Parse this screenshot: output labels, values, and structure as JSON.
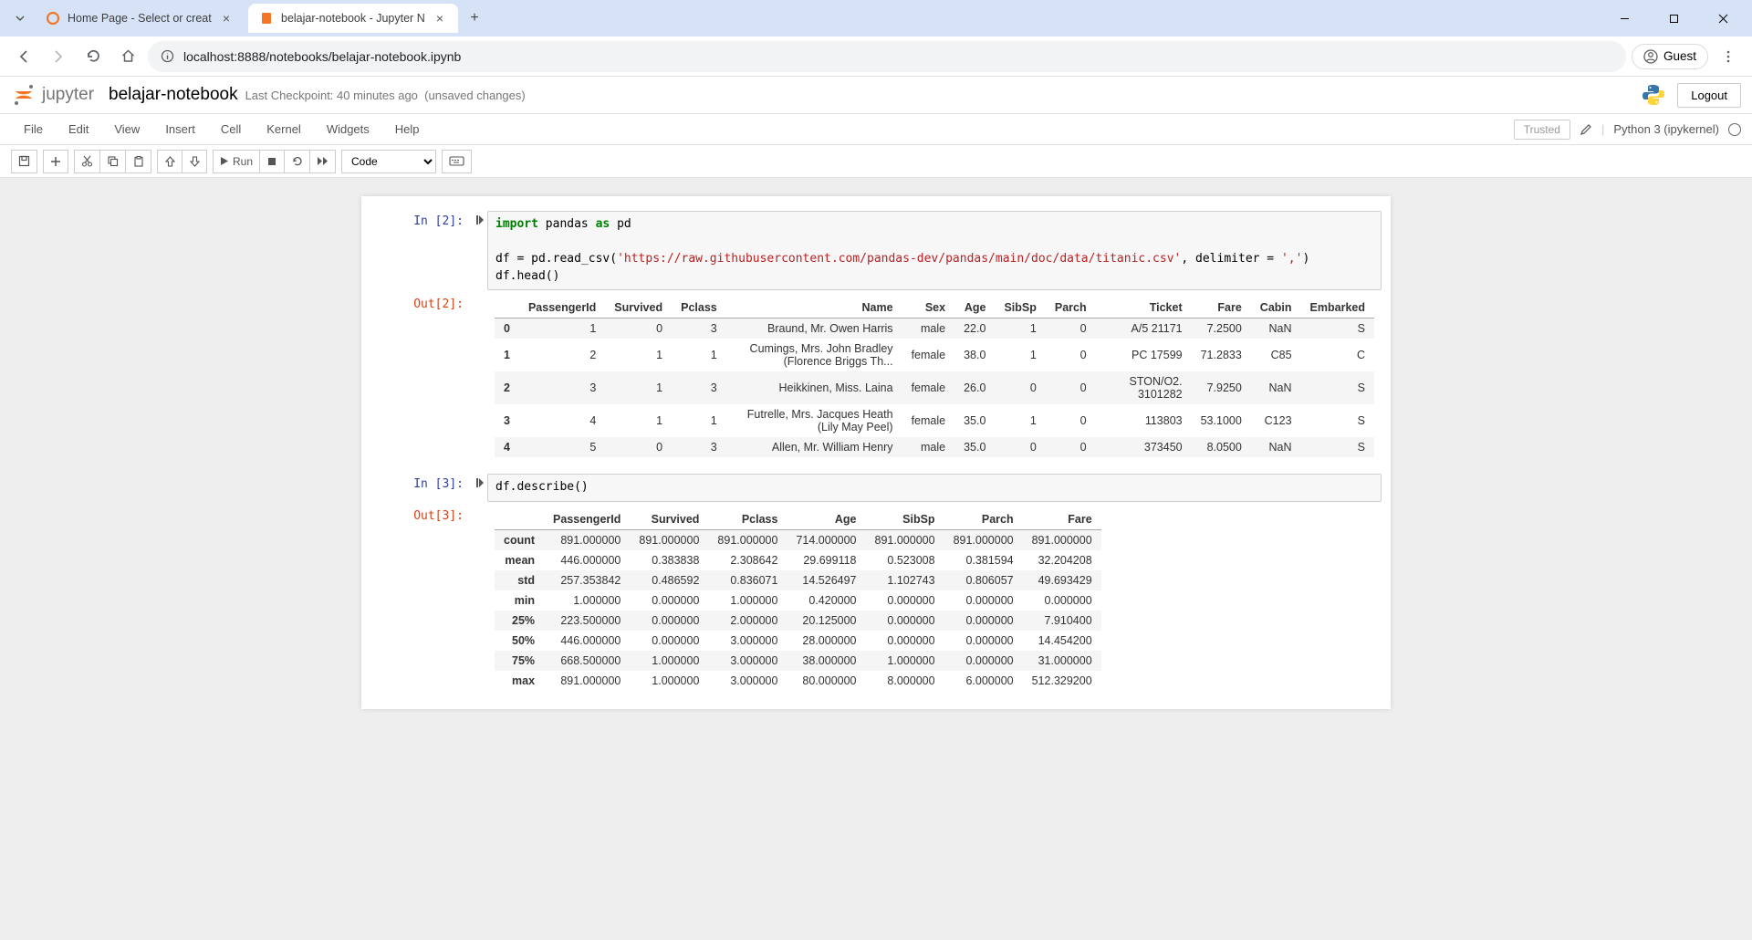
{
  "browser": {
    "tab1_title": "Home Page - Select or create a",
    "tab2_title": "belajar-notebook - Jupyter Not",
    "url": "localhost:8888/notebooks/belajar-notebook.ipynb",
    "guest_label": "Guest"
  },
  "header": {
    "brand": "jupyter",
    "title": "belajar-notebook",
    "checkpoint": "Last Checkpoint: 40 minutes ago",
    "unsaved": "(unsaved changes)",
    "logout": "Logout"
  },
  "menubar": {
    "items": [
      "File",
      "Edit",
      "View",
      "Insert",
      "Cell",
      "Kernel",
      "Widgets",
      "Help"
    ],
    "trusted": "Trusted",
    "kernel": "Python 3 (ipykernel)"
  },
  "toolbar": {
    "run_label": "Run",
    "cell_type": "Code"
  },
  "cells": {
    "c0": {
      "in_label": "In [2]:",
      "out_label": "Out[2]:",
      "code_html": "<span class='kw-g'>import</span> pandas <span class='kw-g'>as</span> pd\n\ndf = pd.read_csv(<span class='str'>'https://raw.githubusercontent.com/pandas-dev/pandas/main/doc/data/titanic.csv'</span>, delimiter = <span class='str'>','</span>)\ndf.head()"
    },
    "c1": {
      "in_label": "In [3]:",
      "out_label": "Out[3]:",
      "code_html": "df.describe()"
    }
  },
  "table_head": {
    "columns": [
      "PassengerId",
      "Survived",
      "Pclass",
      "Name",
      "Sex",
      "Age",
      "SibSp",
      "Parch",
      "Ticket",
      "Fare",
      "Cabin",
      "Embarked"
    ],
    "rows": [
      {
        "idx": "0",
        "cells": [
          "1",
          "0",
          "3",
          "Braund, Mr. Owen Harris",
          "male",
          "22.0",
          "1",
          "0",
          "A/5 21171",
          "7.2500",
          "NaN",
          "S"
        ]
      },
      {
        "idx": "1",
        "cells": [
          "2",
          "1",
          "1",
          "Cumings, Mrs. John Bradley (Florence Briggs Th...",
          "female",
          "38.0",
          "1",
          "0",
          "PC 17599",
          "71.2833",
          "C85",
          "C"
        ]
      },
      {
        "idx": "2",
        "cells": [
          "3",
          "1",
          "3",
          "Heikkinen, Miss. Laina",
          "female",
          "26.0",
          "0",
          "0",
          "STON/O2. 3101282",
          "7.9250",
          "NaN",
          "S"
        ]
      },
      {
        "idx": "3",
        "cells": [
          "4",
          "1",
          "1",
          "Futrelle, Mrs. Jacques Heath (Lily May Peel)",
          "female",
          "35.0",
          "1",
          "0",
          "113803",
          "53.1000",
          "C123",
          "S"
        ]
      },
      {
        "idx": "4",
        "cells": [
          "5",
          "0",
          "3",
          "Allen, Mr. William Henry",
          "male",
          "35.0",
          "0",
          "0",
          "373450",
          "8.0500",
          "NaN",
          "S"
        ]
      }
    ]
  },
  "table_describe": {
    "columns": [
      "PassengerId",
      "Survived",
      "Pclass",
      "Age",
      "SibSp",
      "Parch",
      "Fare"
    ],
    "rows": [
      {
        "idx": "count",
        "cells": [
          "891.000000",
          "891.000000",
          "891.000000",
          "714.000000",
          "891.000000",
          "891.000000",
          "891.000000"
        ]
      },
      {
        "idx": "mean",
        "cells": [
          "446.000000",
          "0.383838",
          "2.308642",
          "29.699118",
          "0.523008",
          "0.381594",
          "32.204208"
        ]
      },
      {
        "idx": "std",
        "cells": [
          "257.353842",
          "0.486592",
          "0.836071",
          "14.526497",
          "1.102743",
          "0.806057",
          "49.693429"
        ]
      },
      {
        "idx": "min",
        "cells": [
          "1.000000",
          "0.000000",
          "1.000000",
          "0.420000",
          "0.000000",
          "0.000000",
          "0.000000"
        ]
      },
      {
        "idx": "25%",
        "cells": [
          "223.500000",
          "0.000000",
          "2.000000",
          "20.125000",
          "0.000000",
          "0.000000",
          "7.910400"
        ]
      },
      {
        "idx": "50%",
        "cells": [
          "446.000000",
          "0.000000",
          "3.000000",
          "28.000000",
          "0.000000",
          "0.000000",
          "14.454200"
        ]
      },
      {
        "idx": "75%",
        "cells": [
          "668.500000",
          "1.000000",
          "3.000000",
          "38.000000",
          "1.000000",
          "0.000000",
          "31.000000"
        ]
      },
      {
        "idx": "max",
        "cells": [
          "891.000000",
          "1.000000",
          "3.000000",
          "80.000000",
          "8.000000",
          "6.000000",
          "512.329200"
        ]
      }
    ]
  }
}
